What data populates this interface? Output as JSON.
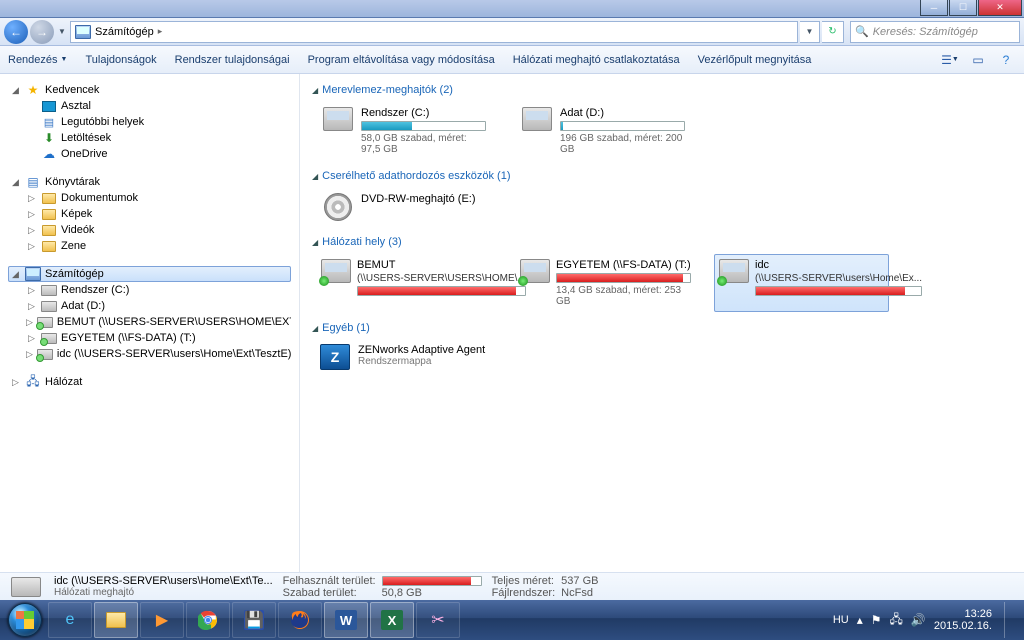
{
  "titlebar": {
    "faint_title": ""
  },
  "address": {
    "location": "Számítógép",
    "arrow": "▸"
  },
  "search": {
    "placeholder": "Keresés: Számítógép"
  },
  "toolbar": {
    "organize": "Rendezés",
    "properties": "Tulajdonságok",
    "sysprops": "Rendszer tulajdonságai",
    "uninstall": "Program eltávolítása vagy módosítása",
    "mapdrive": "Hálózati meghajtó csatlakoztatása",
    "cpanel": "Vezérlőpult megnyitása"
  },
  "tree": {
    "favorites": "Kedvencek",
    "fav_items": {
      "desktop": "Asztal",
      "recent": "Legutóbbi helyek",
      "downloads": "Letöltések",
      "onedrive": "OneDrive"
    },
    "libraries": "Könyvtárak",
    "lib_items": {
      "documents": "Dokumentumok",
      "pictures": "Képek",
      "videos": "Videók",
      "music": "Zene"
    },
    "computer": "Számítógép",
    "comp_items": {
      "c": "Rendszer (C:)",
      "d": "Adat (D:)",
      "s": "BEMUT (\\\\USERS-SERVER\\USERS\\HOME\\EXT) (S:)",
      "t": "EGYETEM (\\\\FS-DATA) (T:)",
      "z": "idc (\\\\USERS-SERVER\\users\\Home\\Ext\\TesztE) (Z:)"
    },
    "network": "Hálózat"
  },
  "sections": {
    "hdd": "Merevlemez-meghajtók (2)",
    "removable": "Cserélhető adathordozós eszközök (1)",
    "netloc": "Hálózati hely (3)",
    "other": "Egyéb (1)"
  },
  "drives": {
    "c": {
      "name": "Rendszer (C:)",
      "sub": "58,0 GB szabad, méret: 97,5 GB",
      "fill_pct": 41,
      "fill_color": "cyan"
    },
    "d": {
      "name": "Adat (D:)",
      "sub": "196 GB szabad, méret: 200 GB",
      "fill_pct": 2,
      "fill_color": "cyan"
    },
    "dvd": {
      "name": "DVD-RW-meghajtó (E:)"
    },
    "bemut": {
      "name": "BEMUT",
      "path": "(\\\\USERS-SERVER\\USERS\\HOME\\...",
      "fill_pct": 95,
      "fill_color": "red"
    },
    "egyetem": {
      "name": "EGYETEM (\\\\FS-DATA) (T:)",
      "sub": "13,4 GB szabad, méret: 253 GB",
      "fill_pct": 95,
      "fill_color": "red"
    },
    "idc": {
      "name": "idc",
      "path": "(\\\\USERS-SERVER\\users\\Home\\Ex...",
      "fill_pct": 90,
      "fill_color": "red"
    }
  },
  "other": {
    "zen_name": "ZENworks Adaptive Agent",
    "zen_sub": "Rendszermappa"
  },
  "details": {
    "name": "idc (\\\\USERS-SERVER\\users\\Home\\Ext\\Te...",
    "type": "Hálózati meghajtó",
    "used_label": "Felhasznált terület:",
    "total_label": "Teljes méret:",
    "total_val": "537 GB",
    "free_label": "Szabad terület:",
    "free_val": "50,8 GB",
    "fs_label": "Fájlrendszer:",
    "fs_val": "NcFsd",
    "fill_pct": 90
  },
  "systray": {
    "lang": "HU",
    "time": "13:26",
    "date": "2015.02.16."
  }
}
